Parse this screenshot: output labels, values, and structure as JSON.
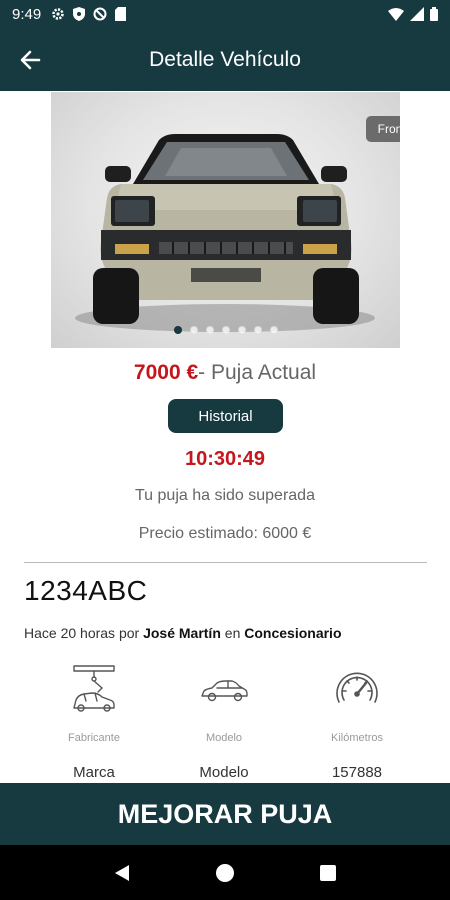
{
  "status_bar": {
    "time": "9:49"
  },
  "app_bar": {
    "title": "Detalle Vehículo",
    "back_icon": "arrow-left-icon"
  },
  "gallery": {
    "view_tag": "Frontal",
    "image_count": 7,
    "active_index": 0
  },
  "auction": {
    "current_bid": "7000 €",
    "current_bid_label": "- Puja Actual",
    "history_button": "Historial",
    "time_left": "10:30:49",
    "outbid_message": "Tu puja ha sido superada",
    "estimated_price": "Precio estimado: 6000 €"
  },
  "vehicle": {
    "plate": "1234ABC",
    "posted_prefix": "Hace 20 horas por ",
    "seller": "José Martín",
    "posted_in": " en ",
    "dealer_type": "Concesionario"
  },
  "specs": [
    {
      "label": "Fabricante",
      "value": "Marca",
      "icon": "factory-robot-icon"
    },
    {
      "label": "Modelo",
      "value": "Modelo",
      "icon": "car-icon"
    },
    {
      "label": "Kilómetros",
      "value": "157888",
      "icon": "speedometer-icon"
    }
  ],
  "cta": {
    "label": "MEJORAR PUJA"
  },
  "colors": {
    "primary": "#163a40",
    "price_red": "#c4161c"
  }
}
